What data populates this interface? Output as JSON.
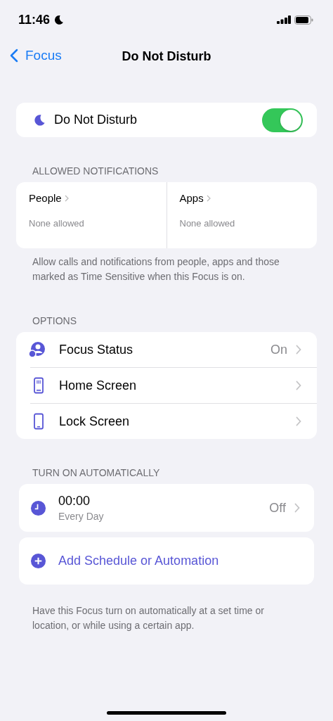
{
  "status_bar": {
    "time": "11:46",
    "focus_on": true
  },
  "nav": {
    "back": "Focus",
    "title": "Do Not Disturb"
  },
  "focus_toggle": {
    "label": "Do Not Disturb",
    "on": true
  },
  "allowed_notifications": {
    "header": "ALLOWED NOTIFICATIONS",
    "items": [
      {
        "label": "People",
        "value": "None allowed"
      },
      {
        "label": "Apps",
        "value": "None allowed"
      }
    ],
    "footer": "Allow calls and notifications from people, apps and those marked as Time Sensitive when this Focus is on."
  },
  "options": {
    "header": "OPTIONS",
    "items": [
      {
        "kind": "status",
        "label": "Focus Status",
        "value": "On"
      },
      {
        "kind": "home",
        "label": "Home Screen"
      },
      {
        "kind": "lock",
        "label": "Lock Screen"
      }
    ]
  },
  "automation": {
    "header": "TURN ON AUTOMATICALLY",
    "schedule": {
      "time": "00:00",
      "repeat": "Every Day",
      "value": "Off"
    },
    "add": "Add Schedule or Automation",
    "footer": "Have this Focus turn on automatically at a set time or location, or while using a certain app."
  }
}
